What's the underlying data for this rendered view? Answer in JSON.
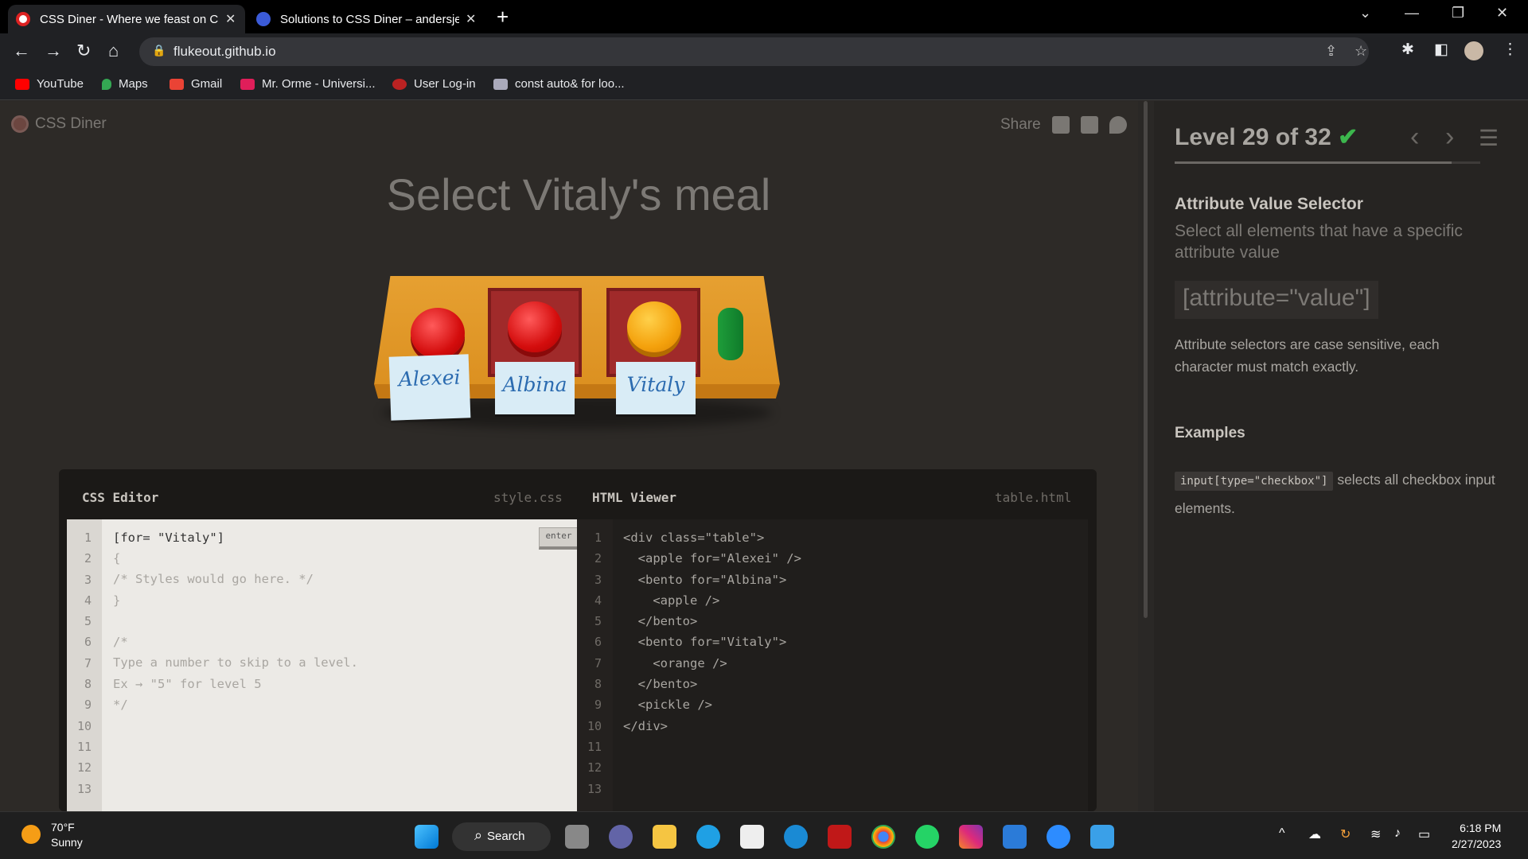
{
  "browser": {
    "tabs": [
      {
        "title": "CSS Diner - Where we feast on CSS",
        "active": true
      },
      {
        "title": "Solutions to CSS Diner – andersje",
        "active": false
      }
    ],
    "url": "flukeout.github.io",
    "bookmarks": [
      "YouTube",
      "Maps",
      "Gmail",
      "Mr. Orme - Universi...",
      "User Log-in",
      "const auto& for loo..."
    ]
  },
  "game": {
    "logo": "CSS Diner",
    "share_label": "Share",
    "order": "Select Vitaly's meal",
    "tags": [
      "Alexei",
      "Albina",
      "Vitaly"
    ]
  },
  "css_editor": {
    "header": "CSS Editor",
    "file": "style.css",
    "enter_label": "enter",
    "line_numbers": "1\n2\n3\n4\n5\n6\n7\n8\n9\n10\n11\n12\n13",
    "input": "[for= \"Vitaly\"]",
    "code_rest": "{\n/* Styles would go here. */\n}\n\n/*\nType a number to skip to a level.\nEx → \"5\" for level 5\n*/"
  },
  "html_viewer": {
    "header": "HTML Viewer",
    "file": "table.html",
    "line_numbers": "1\n2\n3\n4\n5\n6\n7\n8\n9\n10\n11\n12\n13",
    "code": "<div class=\"table\">\n  <apple for=\"Alexei\" />\n  <bento for=\"Albina\">\n    <apple />\n  </bento>\n  <bento for=\"Vitaly\">\n    <orange />\n  </bento>\n  <pickle />\n</div>"
  },
  "sidebar": {
    "level": "Level 29 of 32",
    "check": "✔",
    "progress": 0.906,
    "selector_name": "Attribute Value Selector",
    "selector_title": "Select all elements that have a specific attribute value",
    "syntax": "[attribute=\"value\"]",
    "hint": "Attribute selectors are case sensitive, each character must match exactly.",
    "examples_title": "Examples",
    "example_code": "input[type=\"checkbox\"]",
    "example_text": "selects all checkbox input elements."
  },
  "taskbar": {
    "temp": "70°F",
    "weather": "Sunny",
    "search": "Search",
    "time": "6:18 PM",
    "date": "2/27/2023"
  }
}
